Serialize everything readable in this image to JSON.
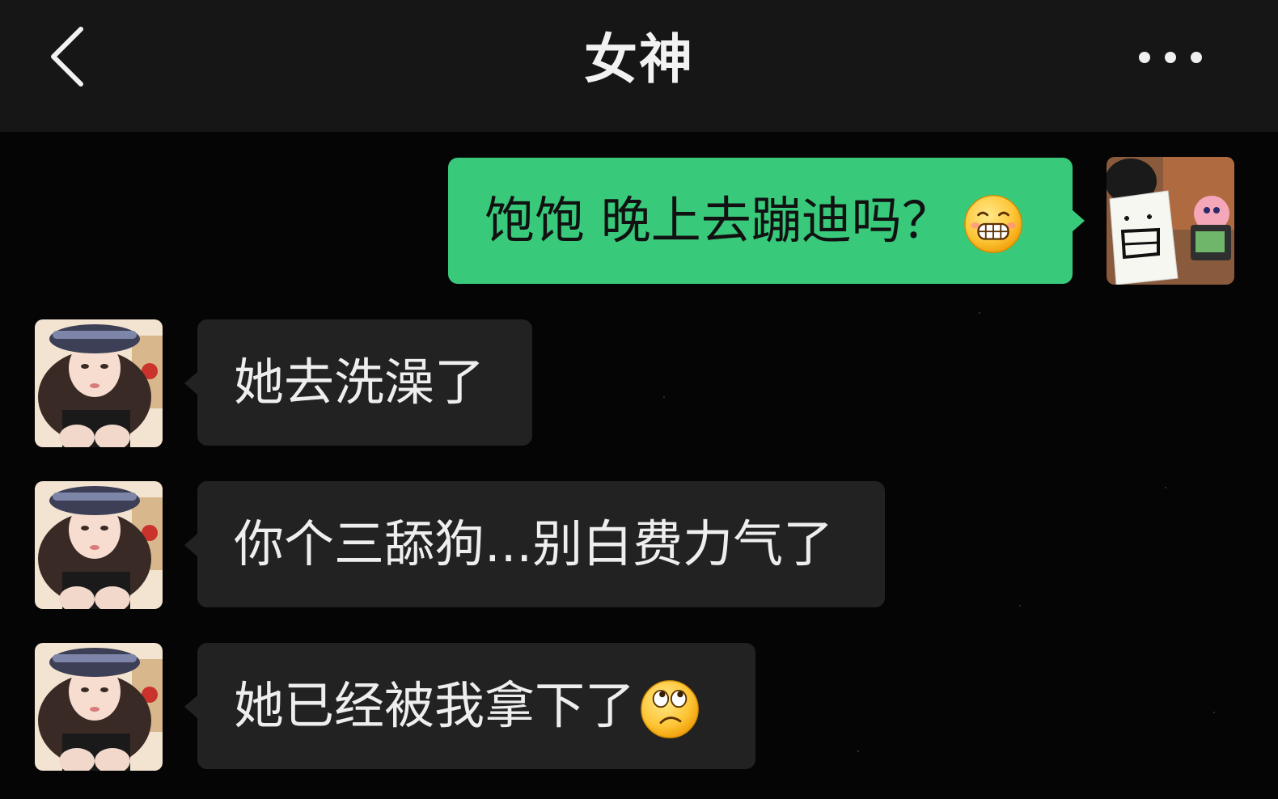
{
  "header": {
    "title": "女神"
  },
  "messages": [
    {
      "direction": "outgoing",
      "text": "饱饱 晚上去蹦迪吗？",
      "emoji": "grinning-face-emoji"
    },
    {
      "direction": "incoming",
      "text": "她去洗澡了"
    },
    {
      "direction": "incoming",
      "text": "你个三舔狗...别白费力气了"
    },
    {
      "direction": "incoming",
      "text": "她已经被我拿下了",
      "emoji": "rolling-eyes-confused-emoji"
    }
  ],
  "colors": {
    "outgoing_bubble": "#39c97b",
    "incoming_bubble": "#222222",
    "header_bg": "#161616",
    "background": "#050505"
  },
  "icons": {
    "back": "chevron-left-icon",
    "more": "more-dots-icon"
  }
}
